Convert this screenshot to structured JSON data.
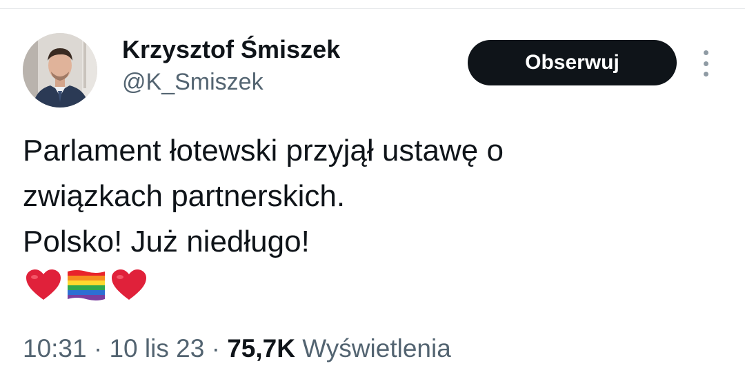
{
  "author": {
    "display_name": "Krzysztof Śmiszek",
    "handle": "@K_Smiszek"
  },
  "follow_button": {
    "label": "Obserwuj"
  },
  "tweet": {
    "lines": [
      "Parlament łotewski przyjął ustawę o",
      "związkach partnerskich.",
      "Polsko! Już niedługo!"
    ],
    "emojis": [
      "red-heart-icon",
      "rainbow-flag-icon",
      "red-heart-icon"
    ]
  },
  "meta": {
    "time": "10:31",
    "separator": "·",
    "date": "10 lis 23",
    "views_count": "75,7K",
    "views_label": "Wyświetlenia"
  },
  "colors": {
    "text_primary": "#0f1419",
    "text_secondary": "#536471",
    "button_bg": "#0f1419",
    "button_text": "#ffffff",
    "heart": "#e0213a"
  }
}
